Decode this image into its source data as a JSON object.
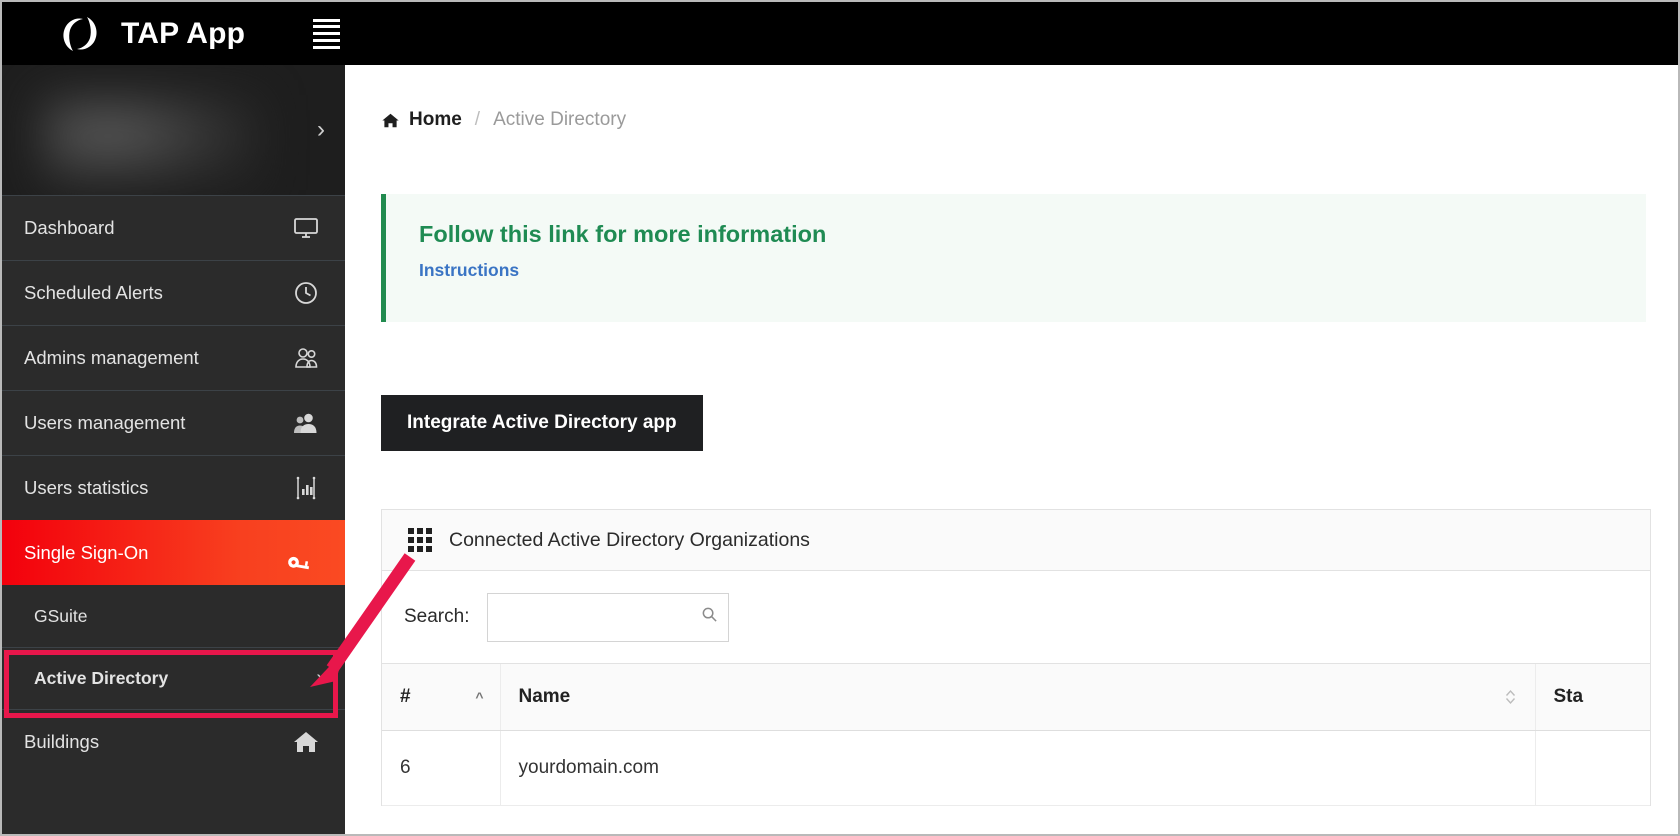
{
  "header": {
    "brand_title": "TAP App",
    "logo_icon": "swirl-logo-icon",
    "menu_icon": "hamburger-menu-icon"
  },
  "sidebar": {
    "profile_chevron": "›",
    "items": [
      {
        "label": "Dashboard",
        "icon": "monitor-icon",
        "active": false
      },
      {
        "label": "Scheduled Alerts",
        "icon": "clock-icon",
        "active": false
      },
      {
        "label": "Admins management",
        "icon": "admin-users-icon",
        "active": false
      },
      {
        "label": "Users management",
        "icon": "users-icon",
        "active": false
      },
      {
        "label": "Users statistics",
        "icon": "bar-chart-icon",
        "active": false
      },
      {
        "label": "Single Sign-On",
        "icon": "key-icon",
        "active": true
      }
    ],
    "sub_items": [
      {
        "label": "GSuite",
        "chevron": ""
      },
      {
        "label": "Active Directory",
        "chevron": "›"
      }
    ],
    "bottom_items": [
      {
        "label": "Buildings",
        "icon": "home-icon"
      }
    ],
    "active_color": "#f3000c",
    "highlight_color": "#e8174b"
  },
  "main": {
    "breadcrumb": {
      "home_icon": "home-icon",
      "home": "Home",
      "separator": "/",
      "current": "Active Directory"
    },
    "alert": {
      "title": "Follow this link for more information",
      "link": "Instructions",
      "accent_color": "#218b4f",
      "link_color": "#3a74c4"
    },
    "integrate_button": "Integrate Active Directory app",
    "panel": {
      "icon": "grid-icon",
      "title": "Connected Active Directory Organizations",
      "search": {
        "label": "Search:",
        "value": "",
        "placeholder": "",
        "icon": "magnifier-icon"
      },
      "table": {
        "columns": [
          {
            "label": "#",
            "sort": "asc"
          },
          {
            "label": "Name",
            "sort": "both"
          },
          {
            "label": "Sta",
            "sort": "none"
          }
        ],
        "rows": [
          {
            "num": "6",
            "name": "yourdomain.com",
            "status": ""
          }
        ]
      }
    }
  }
}
